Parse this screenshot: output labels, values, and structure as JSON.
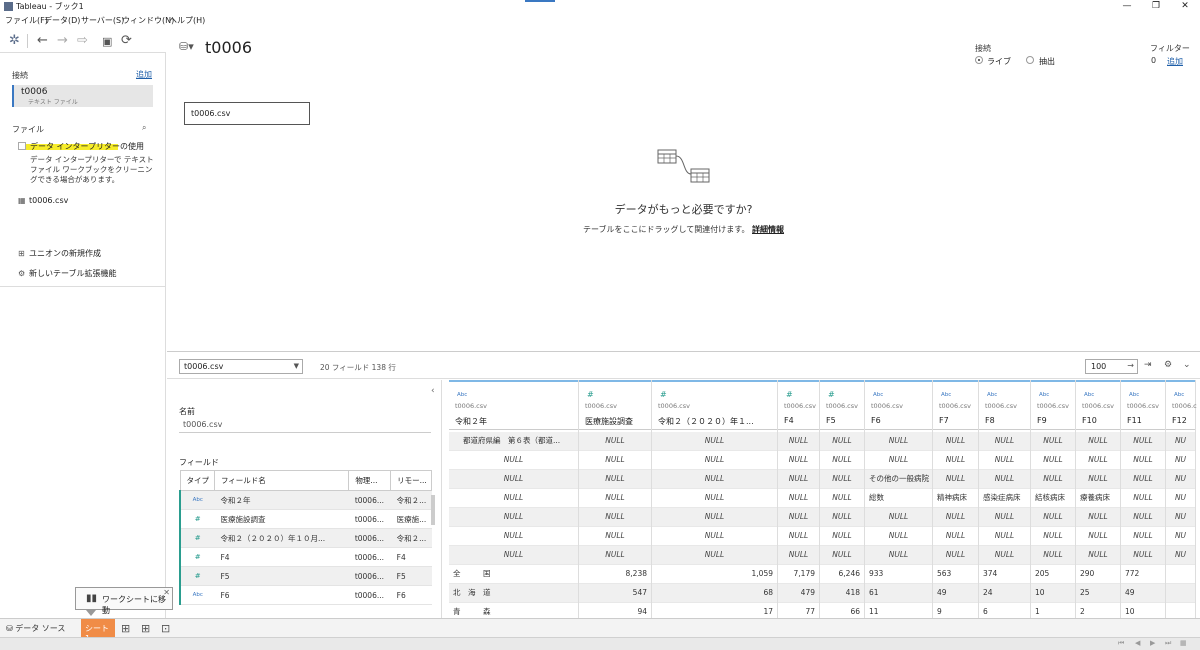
{
  "window": {
    "title": "Tableau - ブック1",
    "min": "—",
    "max": "❐",
    "close": "✕"
  },
  "menu": [
    "ファイル(F)",
    "データ(D)",
    "サーバー(S)",
    "ウィンドウ(N)",
    "ヘルプ(H)"
  ],
  "left": {
    "connections_label": "接続",
    "add_link": "追加",
    "connection": {
      "name": "t0006",
      "type": "テキスト ファイル"
    },
    "files_label": "ファイル",
    "interpreter_label": "データ インタープリターの使用",
    "interpreter_desc": "データ インタープリターで テキスト ファイル ワークブックをクリーニングできる場合があります。",
    "file_item": "t0006.csv",
    "new_union": "ユニオンの新規作成",
    "new_table_ext": "新しいテーブル拡張機能"
  },
  "canvas": {
    "datasource_name": "t0006",
    "connection_label": "接続",
    "live_label": "ライブ",
    "extract_label": "抽出",
    "filter_label": "フィルター",
    "filter_count": "0",
    "filter_add": "追加",
    "table_box": "t0006.csv",
    "more_data_title": "データがもっと必要ですか?",
    "more_data_sub": "テーブルをここにドラッグして関連付けます。",
    "more_data_link": "詳細情報"
  },
  "gridbar": {
    "table_select": "t0006.csv",
    "field_count": "20 フィールド 138 行",
    "rows_value": "100",
    "rows_arrow": "→"
  },
  "meta": {
    "name_label": "名前",
    "name_value": "t0006.csv",
    "fields_label": "フィールド",
    "headers": [
      "タイプ",
      "フィールド名",
      "物理...",
      "リモー..."
    ],
    "rows": [
      {
        "type": "Abc",
        "name": "令和２年",
        "phys": "t0006...",
        "remote": "令和２..."
      },
      {
        "type": "#",
        "name": "医療施設調査",
        "phys": "t0006...",
        "remote": "医療施..."
      },
      {
        "type": "#",
        "name": "令和２（２０２０）年１０月...",
        "phys": "t0006...",
        "remote": "令和２..."
      },
      {
        "type": "#",
        "name": "F4",
        "phys": "t0006...",
        "remote": "F4"
      },
      {
        "type": "#",
        "name": "F5",
        "phys": "t0006...",
        "remote": "F5"
      },
      {
        "type": "Abc",
        "name": "F6",
        "phys": "t0006...",
        "remote": "F6"
      }
    ]
  },
  "grid": {
    "columns": [
      {
        "type": "Abc",
        "src": "t0006.csv",
        "name": "令和２年"
      },
      {
        "type": "#",
        "src": "t0006.csv",
        "name": "医療施設調査"
      },
      {
        "type": "#",
        "src": "t0006.csv",
        "name": "令和２（２０２０）年１..."
      },
      {
        "type": "#",
        "src": "t0006.csv",
        "name": "F4"
      },
      {
        "type": "#",
        "src": "t0006.csv",
        "name": "F5"
      },
      {
        "type": "Abc",
        "src": "t0006.csv",
        "name": "F6"
      },
      {
        "type": "Abc",
        "src": "t0006.csv",
        "name": "F7"
      },
      {
        "type": "Abc",
        "src": "t0006.csv",
        "name": "F8"
      },
      {
        "type": "Abc",
        "src": "t0006.csv",
        "name": "F9"
      },
      {
        "type": "Abc",
        "src": "t0006.csv",
        "name": "F10"
      },
      {
        "type": "Abc",
        "src": "t0006.csv",
        "name": "F11"
      },
      {
        "type": "Abc",
        "src": "t0006.c",
        "name": "F12"
      }
    ],
    "rows": [
      [
        "都道府県編　第６表（都道...",
        "NULL",
        "NULL",
        "NULL",
        "NULL",
        "NULL",
        "NULL",
        "NULL",
        "NULL",
        "NULL",
        "NULL",
        "NU"
      ],
      [
        "NULL",
        "NULL",
        "NULL",
        "NULL",
        "NULL",
        "NULL",
        "NULL",
        "NULL",
        "NULL",
        "NULL",
        "NULL",
        "NU"
      ],
      [
        "NULL",
        "NULL",
        "NULL",
        "NULL",
        "NULL",
        "その他の一般病院",
        "NULL",
        "NULL",
        "NULL",
        "NULL",
        "NULL",
        "NU"
      ],
      [
        "NULL",
        "NULL",
        "NULL",
        "NULL",
        "NULL",
        "総数",
        "精神病床",
        "感染症病床",
        "結核病床",
        "療養病床",
        "NULL",
        "NU"
      ],
      [
        "NULL",
        "NULL",
        "NULL",
        "NULL",
        "NULL",
        "NULL",
        "NULL",
        "NULL",
        "NULL",
        "NULL",
        "NULL",
        "NU"
      ],
      [
        "NULL",
        "NULL",
        "NULL",
        "NULL",
        "NULL",
        "NULL",
        "NULL",
        "NULL",
        "NULL",
        "NULL",
        "NULL",
        "NU"
      ],
      [
        "NULL",
        "NULL",
        "NULL",
        "NULL",
        "NULL",
        "NULL",
        "NULL",
        "NULL",
        "NULL",
        "NULL",
        "NULL",
        "NU"
      ],
      [
        "全　　　国",
        "8,238",
        "1,059",
        "7,179",
        "6,246",
        "933",
        "563",
        "374",
        "205",
        "290",
        "772",
        ""
      ],
      [
        "北　海　道",
        "547",
        "68",
        "479",
        "418",
        "61",
        "49",
        "24",
        "10",
        "25",
        "49",
        ""
      ],
      [
        "青　　　森",
        "94",
        "17",
        "77",
        "66",
        "11",
        "9",
        "6",
        "1",
        "2",
        "10",
        ""
      ]
    ]
  },
  "bottom": {
    "datasource_tab": "データ ソース",
    "sheet_tab": "シート 1",
    "tooltip": "ワークシートに移動"
  }
}
